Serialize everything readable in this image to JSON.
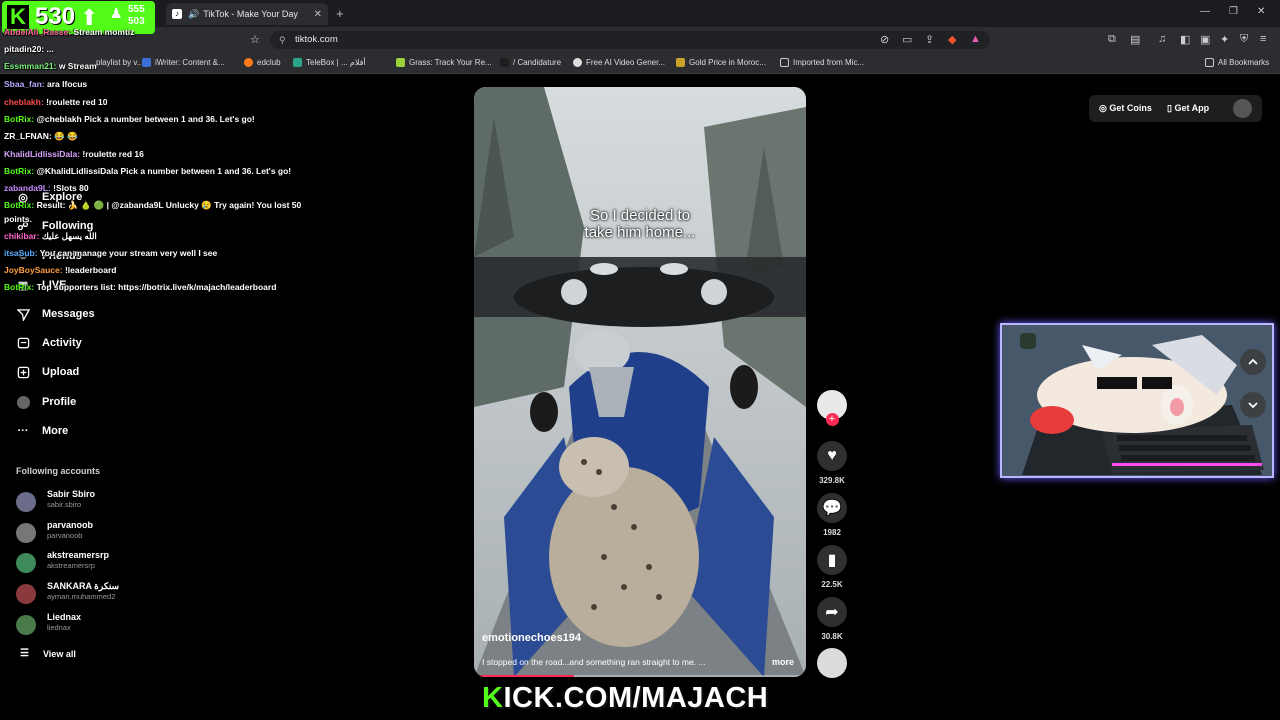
{
  "browser": {
    "tab_title": "TikTok - Make Your Day",
    "url": "tiktok.com",
    "bookmarks": [
      "playlist by v...",
      "iWriter: Content &...",
      "edclub",
      "TeleBox | ... أفلام",
      "Grass: Track Your Re...",
      "/ Candidature",
      "Free AI Video Gener...",
      "Gold Price in Moroc...",
      "Imported from Mic..."
    ],
    "all_bookmarks": "All Bookmarks"
  },
  "overlay": {
    "viewers": "530",
    "followers_top": "555",
    "followers_bottom": "503",
    "chat": [
      {
        "user": "AbdelAli_Rasse:",
        "msg": "Stream momtiz",
        "color": "#ff5fa2"
      },
      {
        "user": "pitadin20:",
        "msg": "...",
        "color": "#ffffff"
      },
      {
        "user": "Essmman21:",
        "msg": "w Stream",
        "color": "#7cf57c"
      },
      {
        "user": "Sbaa_fan:",
        "msg": "ara lfocus",
        "color": "#b9a6ff"
      },
      {
        "user": "cheblakh:",
        "msg": "!roulette red 10",
        "color": "#ff4d4d"
      },
      {
        "user": "BotRix:",
        "msg": "@cheblakh Pick a number between 1 and 36. Let's go!",
        "color": "#53fc18"
      },
      {
        "user": "ZR_LFNAN:",
        "msg": "😂 😂",
        "color": "#ffffff"
      },
      {
        "user": "KhalidLidlissiDala:",
        "msg": "!roulette red 16",
        "color": "#d9a6ff"
      },
      {
        "user": "BotRix:",
        "msg": "@KhalidLidlissiDala Pick a number between 1 and 36. Let's go!",
        "color": "#53fc18"
      },
      {
        "user": "zabanda9L:",
        "msg": "!Slots 80",
        "color": "#c58cff"
      },
      {
        "user": "BotRix:",
        "msg": "Result: 🍌 🍐 🟢 | @zabanda9L Unlucky 😢 Try again! You lost 50",
        "color": "#53fc18"
      },
      {
        "user": "",
        "msg": "points.",
        "color": "#ffffff"
      },
      {
        "user": "chikibar:",
        "msg": "الله يسهل عليك",
        "color": "#ff66cc"
      },
      {
        "user": "itsaSub:",
        "msg": "You can manage your stream very well I see",
        "color": "#5ab0ff"
      },
      {
        "user": "JoyBoySauce:",
        "msg": "!leaderboard",
        "color": "#ff9f40"
      },
      {
        "user": "BotRix:",
        "msg": "Top supporters list: https://botrix.live/k/majach/leaderboard",
        "color": "#53fc18"
      }
    ],
    "stream_url_prefix": "K",
    "stream_url_rest": "ICK.COM/MAJACH"
  },
  "sidebar": {
    "nav": [
      {
        "label": "Explore",
        "icon": "compass-icon"
      },
      {
        "label": "Following",
        "icon": "following-icon"
      },
      {
        "label": "Friends",
        "icon": "friends-icon"
      },
      {
        "label": "LIVE",
        "icon": "live-icon"
      },
      {
        "label": "Messages",
        "icon": "messages-icon"
      },
      {
        "label": "Activity",
        "icon": "activity-icon"
      },
      {
        "label": "Upload",
        "icon": "upload-icon"
      },
      {
        "label": "Profile",
        "icon": "profile-icon"
      },
      {
        "label": "More",
        "icon": "more-icon"
      }
    ],
    "following_title": "Following accounts",
    "accounts": [
      {
        "name": "Sabir Sbiro",
        "handle": "sabir.sbiro",
        "color": "#6b6b8a"
      },
      {
        "name": "parvanoob",
        "handle": "parvanoob",
        "color": "#777777"
      },
      {
        "name": "akstreamersrp",
        "handle": "akstreamersrp",
        "color": "#3e8a5a"
      },
      {
        "name": "SANKARA سنكرة",
        "handle": "ayman.muhammed2",
        "color": "#8a3a3a"
      },
      {
        "name": "Liednax",
        "handle": "liednax",
        "color": "#4a7a4a"
      }
    ],
    "view_all": "View all"
  },
  "video": {
    "caption_line1": "So I decided to",
    "caption_line2": "take him home...",
    "username": "emotionechoes194",
    "description": "I stopped on the road...and something ran straight to me. ...",
    "more": "more",
    "progress": 0.3
  },
  "actions": {
    "likes": "329.8K",
    "comments": "1982",
    "saves": "22.5K",
    "shares": "30.8K"
  },
  "topbar": {
    "get_coins": "Get Coins",
    "get_app": "Get App"
  },
  "colors": {
    "kick_green": "#53fc18",
    "tiktok_red": "#fe2c55"
  }
}
